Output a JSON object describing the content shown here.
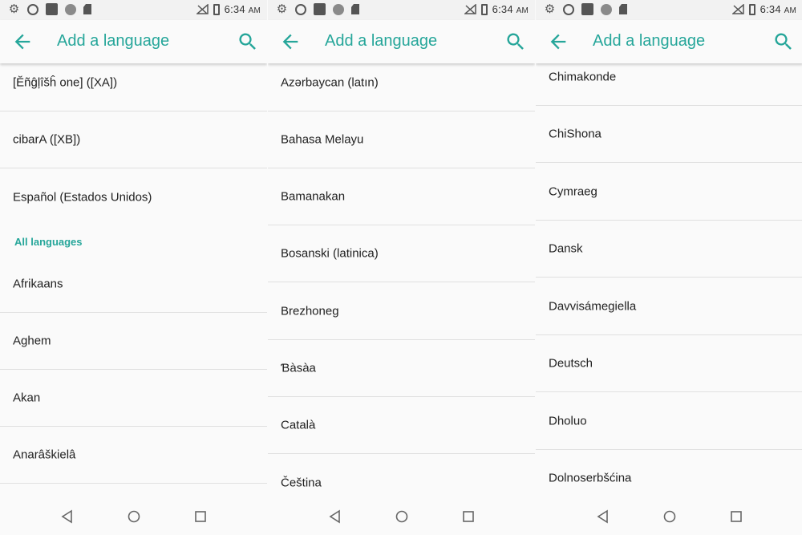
{
  "status_bar": {
    "time": "6:34",
    "ampm": "AM",
    "icons": [
      "gear-icon",
      "ring-icon",
      "square-icon",
      "circle-icon",
      "sim-icon",
      "no-signal-icon",
      "battery-charging-icon"
    ]
  },
  "app_bar": {
    "title": "Add a language",
    "back_icon": "arrow-back-icon",
    "search_icon": "search-icon"
  },
  "accent_color": "#26a69a",
  "screens": [
    {
      "items": [
        {
          "label": "[Ĕñĝļîšĥ one] ([XA])"
        },
        {
          "label": "cibarA ([XB])"
        },
        {
          "label": "Español (Estados Unidos)"
        }
      ],
      "section_header": "All languages",
      "items_after": [
        {
          "label": "Afrikaans"
        },
        {
          "label": "Aghem"
        },
        {
          "label": "Akan"
        },
        {
          "label": "Anarâškielâ"
        }
      ]
    },
    {
      "items": [
        {
          "label": "Azərbaycan (latın)"
        },
        {
          "label": "Bahasa Melayu"
        },
        {
          "label": "Bamanakan"
        },
        {
          "label": "Bosanski (latinica)"
        },
        {
          "label": "Brezhoneg"
        },
        {
          "label": "Ɓàsàa"
        },
        {
          "label": "Català"
        },
        {
          "label": "Čeština"
        }
      ]
    },
    {
      "items": [
        {
          "label": "Chimakonde"
        },
        {
          "label": "ChiShona"
        },
        {
          "label": "Cymraeg"
        },
        {
          "label": "Dansk"
        },
        {
          "label": "Davvisámegiella"
        },
        {
          "label": "Deutsch"
        },
        {
          "label": "Dholuo"
        },
        {
          "label": "Dolnoserbšćina"
        }
      ]
    }
  ],
  "nav_bar": {
    "back": "nav-back-triangle-icon",
    "home": "nav-home-circle-icon",
    "recents": "nav-recents-square-icon"
  }
}
